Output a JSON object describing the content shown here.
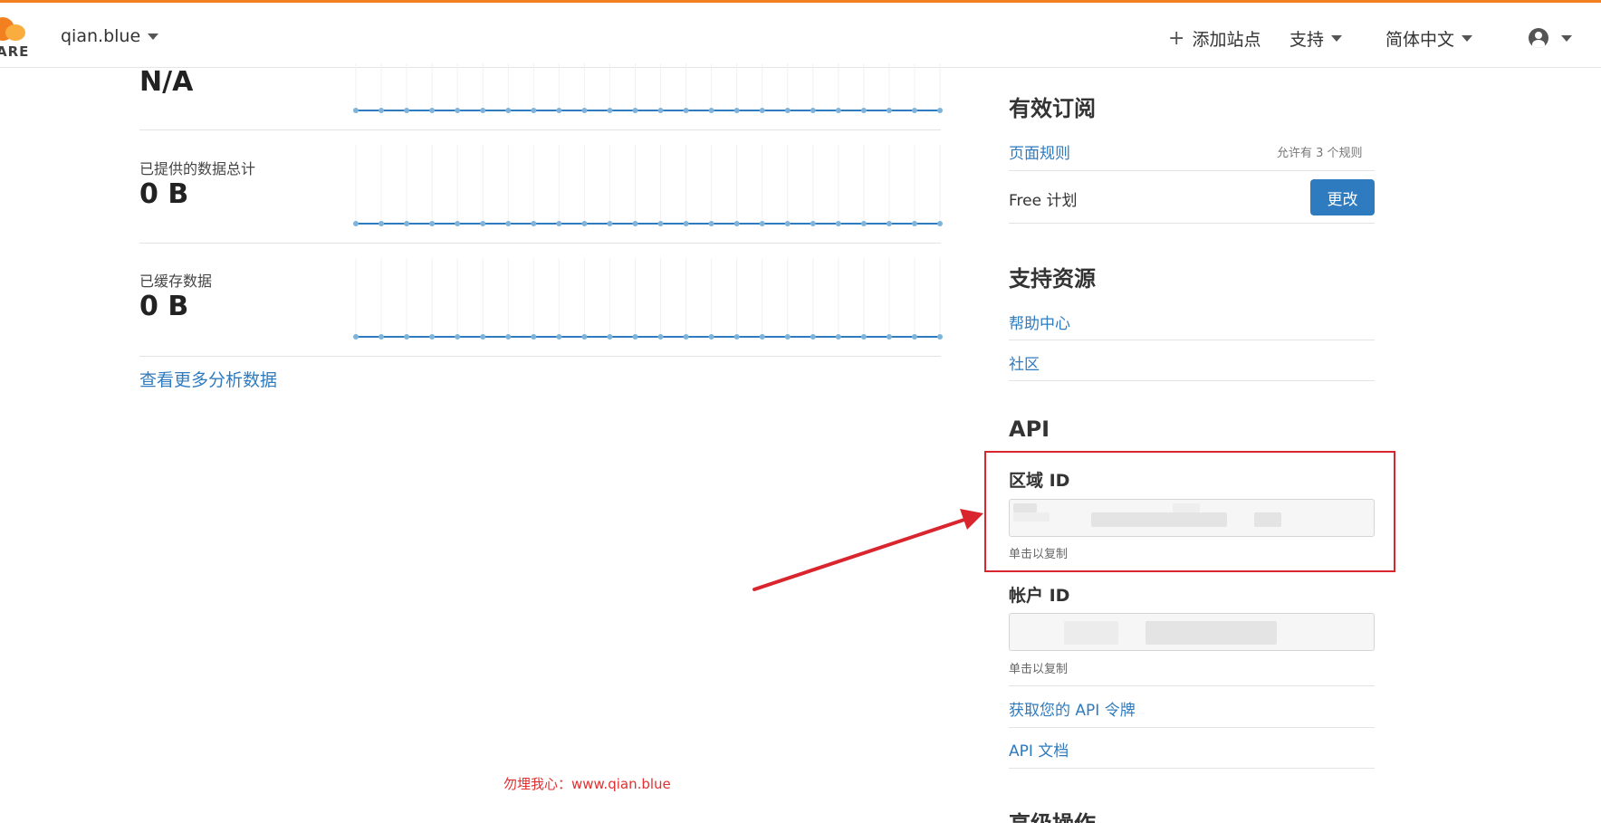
{
  "header": {
    "logo_text": "ARE",
    "zone": "qian.blue",
    "add_site": "添加站点",
    "support": "支持",
    "language": "简体中文"
  },
  "analytics": {
    "top_value": "N/A",
    "metrics": [
      {
        "label": "已提供的数据总计",
        "value": "0 B"
      },
      {
        "label": "已缓存数据",
        "value": "0 B"
      }
    ],
    "more_link": "查看更多分析数据"
  },
  "subscriptions": {
    "title": "有效订阅",
    "page_rules": "页面规则",
    "page_rules_note": "允许有 3 个规则",
    "plan": "Free 计划",
    "change_button": "更改"
  },
  "support_resources": {
    "title": "支持资源",
    "help_center": "帮助中心",
    "community": "社区"
  },
  "api": {
    "title": "API",
    "zone_id_label": "区域 ID",
    "zone_id_hint": "单击以复制",
    "account_id_label": "帐户 ID",
    "account_id_hint": "单击以复制",
    "get_token": "获取您的 API 令牌",
    "docs": "API 文档"
  },
  "advanced": {
    "title": "高级操作"
  },
  "watermark": "勿埋我心：www.qian.blue",
  "colors": {
    "accent_orange": "#f38020",
    "link_blue": "#2f7bbf",
    "annotation_red": "#d9262e",
    "sparkline": "#2f7bbf"
  },
  "sparkline_points": 24
}
